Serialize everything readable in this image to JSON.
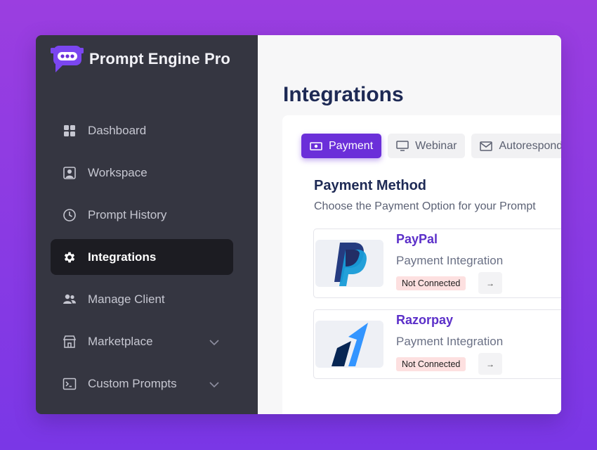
{
  "app": {
    "name": "Prompt Engine Pro"
  },
  "sidebar": {
    "items": [
      {
        "label": "Dashboard",
        "icon": "grid-icon"
      },
      {
        "label": "Workspace",
        "icon": "user-frame-icon"
      },
      {
        "label": "Prompt History",
        "icon": "clock-icon"
      },
      {
        "label": "Integrations",
        "icon": "gear-icon",
        "active": true
      },
      {
        "label": "Manage Client",
        "icon": "users-icon"
      },
      {
        "label": "Marketplace",
        "icon": "store-icon",
        "expandable": true
      },
      {
        "label": "Custom Prompts",
        "icon": "terminal-icon",
        "expandable": true
      }
    ]
  },
  "main": {
    "title": "Integrations",
    "tabs": [
      {
        "label": "Payment",
        "icon": "money-icon",
        "active": true
      },
      {
        "label": "Webinar",
        "icon": "monitor-icon"
      },
      {
        "label": "Autorespond",
        "icon": "mail-icon"
      }
    ],
    "section": {
      "title": "Payment Method",
      "subtitle": "Choose the Payment Option for your Prompt"
    },
    "integrations": [
      {
        "name": "PayPal",
        "description": "Payment Integration",
        "status": "Not Connected",
        "action": "→"
      },
      {
        "name": "Razorpay",
        "description": "Payment Integration",
        "status": "Not Connected",
        "action": "→"
      }
    ]
  },
  "colors": {
    "accent": "#6b2fd9",
    "sidebar_bg": "#353641",
    "active_item_bg": "#1c1c22",
    "badge_bg": "#fde0e0",
    "title": "#1e2a55"
  }
}
